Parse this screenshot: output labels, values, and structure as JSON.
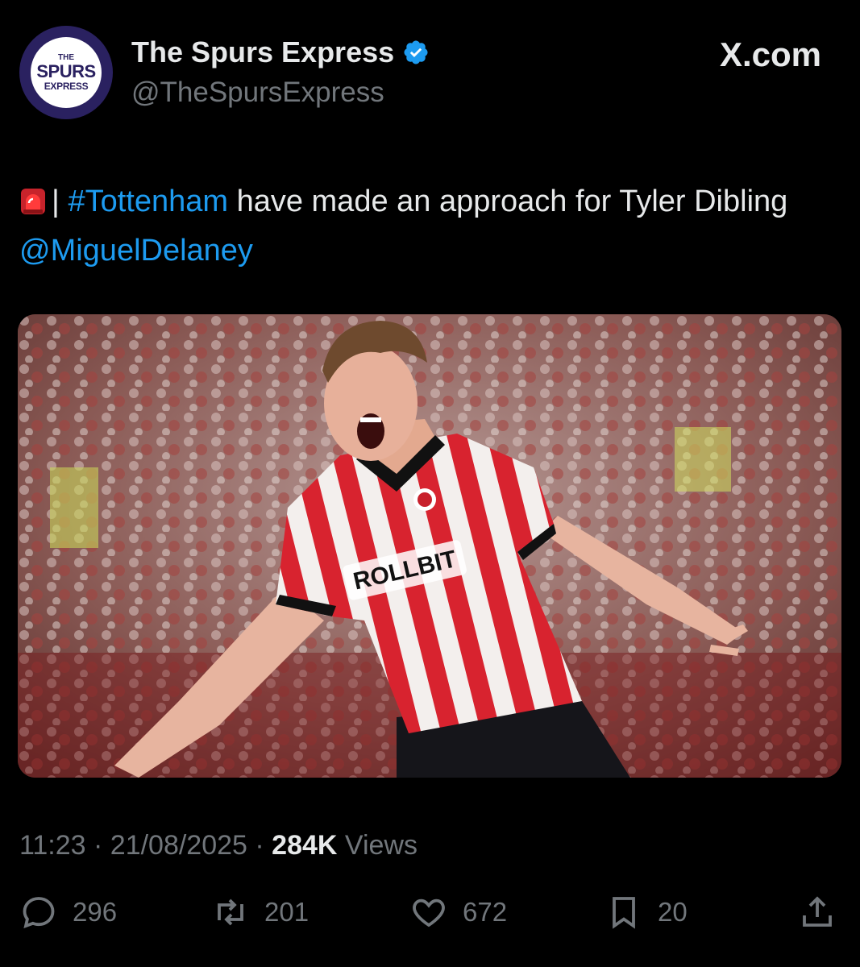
{
  "author": {
    "display_name": "The Spurs Express",
    "handle": "@TheSpursExpress",
    "avatar_text": [
      "THE",
      "SPURS",
      "EXPRESS"
    ]
  },
  "site_label": "X.com",
  "tweet": {
    "separator": "|",
    "hashtag": "#Tottenham",
    "text_middle": " have made an approach for Tyler Dibling ",
    "mention": "@MiguelDelaney",
    "emoji": "siren-icon"
  },
  "meta": {
    "time": "11:23",
    "dot1": " · ",
    "date": "21/08/2025",
    "dot2": " · ",
    "views_count": "284K",
    "views_label": " Views"
  },
  "actions": {
    "replies": "296",
    "reposts": "201",
    "likes": "672",
    "bookmarks": "20"
  },
  "media": {
    "shirt_sponsor": "ROLLBIT"
  },
  "colors": {
    "background": "#000000",
    "text": "#e7e9ea",
    "muted": "#71767b",
    "link": "#1d9bf0",
    "verified": "#1d9bf0"
  }
}
